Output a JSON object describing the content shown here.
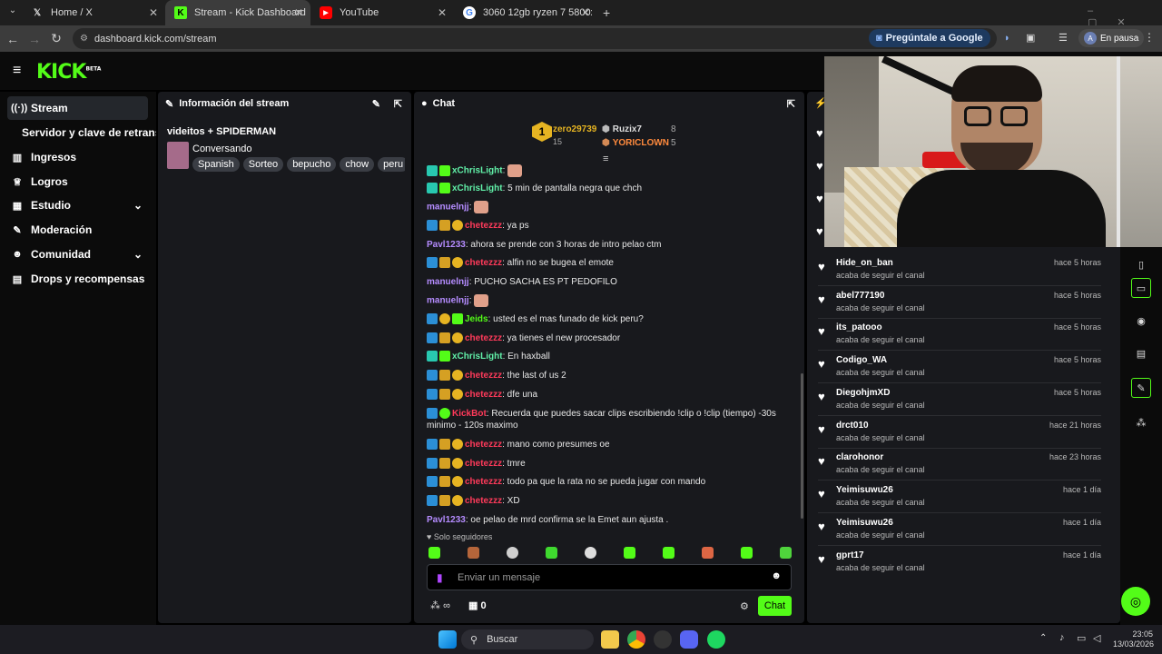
{
  "browser": {
    "tabs": [
      {
        "title": "Home / X",
        "icon": "x-logo-icon"
      },
      {
        "title": "Stream - Kick Dashboard",
        "icon": "kick-logo-icon"
      },
      {
        "title": "YouTube",
        "icon": "youtube-logo-icon"
      },
      {
        "title": "3060 12gb ryzen 7 5800x - Bus",
        "icon": "google-logo-icon"
      }
    ],
    "url": "dashboard.kick.com/stream",
    "ask_google": "Pregúntale a Google",
    "profile_status": "En pausa",
    "profile_initial": "A"
  },
  "kick": {
    "logo": "KICK",
    "logo_badge": "BETA",
    "sidebar": [
      {
        "label": "Stream",
        "icon": "broadcast-icon"
      },
      {
        "label": "Servidor y clave de retransm",
        "icon": ""
      },
      {
        "label": "Ingresos",
        "icon": "chart-icon"
      },
      {
        "label": "Logros",
        "icon": "trophy-icon"
      },
      {
        "label": "Estudio",
        "icon": "grid-icon"
      },
      {
        "label": "Moderación",
        "icon": "wrench-icon"
      },
      {
        "label": "Comunidad",
        "icon": "people-icon"
      },
      {
        "label": "Drops y recompensas",
        "icon": "gift-icon"
      }
    ],
    "stream_info": {
      "title_header": "Información del stream",
      "stream_title": "videitos + SPIDERMAN",
      "category": "Conversando",
      "tags": [
        "Spanish",
        "Sorteo",
        "bepucho",
        "chow",
        "peru"
      ]
    },
    "chat": {
      "title": "Chat",
      "leaderboard": [
        {
          "rank": "1",
          "name": "zero29739",
          "count": "15"
        },
        {
          "name": "Ruzix7",
          "count": "8"
        },
        {
          "name": "YORICLOWN",
          "count": "5"
        }
      ],
      "messages": [
        {
          "user": "xChrisLight",
          "text": "",
          "color": "mint"
        },
        {
          "user": "xChrisLight",
          "text": ": 5 min de pantalla negra que chch",
          "color": "mint"
        },
        {
          "user": "manuelnjj",
          "text": ":",
          "color": "purple"
        },
        {
          "user": "chetezzz",
          "text": ": ya ps",
          "color": "red"
        },
        {
          "user": "Pavl1233",
          "text": ": ahora se prende con 3 horas de intro pelao ctm",
          "color": "purple"
        },
        {
          "user": "chetezzz",
          "text": ": alfin no se bugea el emote",
          "color": "red"
        },
        {
          "user": "manuelnjj",
          "text": ": PUCHO SACHA ES PT PEDOFILO",
          "color": "purple"
        },
        {
          "user": "manuelnjj",
          "text": ":",
          "color": "purple"
        },
        {
          "user": "Jeids",
          "text": ": usted es el mas funado de kick peru?",
          "color": "green"
        },
        {
          "user": "chetezzz",
          "text": ": ya tienes el new procesador",
          "color": "red"
        },
        {
          "user": "xChrisLight",
          "text": ": En haxball",
          "color": "mint"
        },
        {
          "user": "chetezzz",
          "text": ": the last of us 2",
          "color": "red"
        },
        {
          "user": "chetezzz",
          "text": ": dfe una",
          "color": "red"
        },
        {
          "user": "KickBot",
          "text": ": Recuerda que puedes sacar clips escribiendo !clip o !clip (tiempo) -30s minimo - 120s maximo",
          "color": "red"
        },
        {
          "user": "chetezzz",
          "text": ": mano como presumes oe",
          "color": "red"
        },
        {
          "user": "chetezzz",
          "text": ": tmre",
          "color": "red"
        },
        {
          "user": "chetezzz",
          "text": ": todo pa que la rata no se pueda jugar con mando",
          "color": "red"
        },
        {
          "user": "chetezzz",
          "text": ": XD",
          "color": "red"
        },
        {
          "user": "Pavl1233",
          "text": ": oe pelao de mrd confirma se la Emet aun ajusta .",
          "color": "purple"
        }
      ],
      "followers_only": "Solo seguidores",
      "input_placeholder": "Enviar un mensaje",
      "infinity": "∞",
      "store_count": "0",
      "send_button": "Chat"
    },
    "activity": [
      {
        "name": "Hide_on_ban",
        "sub": "acaba de seguir el canal",
        "time": "hace 5 horas"
      },
      {
        "name": "abel777190",
        "sub": "acaba de seguir el canal",
        "time": "hace 5 horas"
      },
      {
        "name": "its_patooo",
        "sub": "acaba de seguir el canal",
        "time": "hace 5 horas"
      },
      {
        "name": "Codigo_WA",
        "sub": "acaba de seguir el canal",
        "time": "hace 5 horas"
      },
      {
        "name": "DiegohjmXD",
        "sub": "acaba de seguir el canal",
        "time": "hace 5 horas"
      },
      {
        "name": "drct010",
        "sub": "acaba de seguir el canal",
        "time": "hace 21 horas"
      },
      {
        "name": "clarohonor",
        "sub": "acaba de seguir el canal",
        "time": "hace 23 horas"
      },
      {
        "name": "Yeimisuwu26",
        "sub": "acaba de seguir el canal",
        "time": "hace 1 día"
      },
      {
        "name": "Yeimisuwu26",
        "sub": "acaba de seguir el canal",
        "time": "hace 1 día"
      },
      {
        "name": "gprt17",
        "sub": "acaba de seguir el canal",
        "time": "hace 1 día"
      }
    ]
  },
  "taskbar": {
    "search": "Buscar",
    "time": "23:05",
    "date": "13/03/2026"
  }
}
